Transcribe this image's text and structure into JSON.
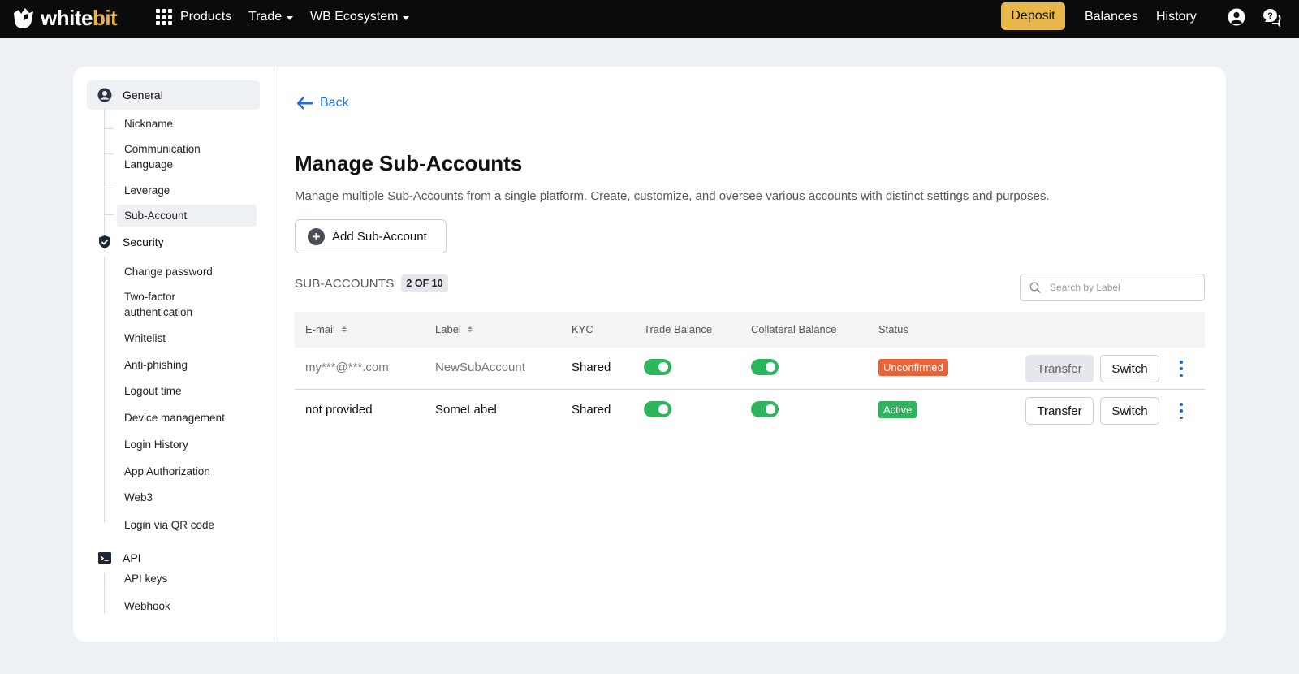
{
  "topnav": {
    "logo_text_main": "white",
    "logo_text_accent": "bit",
    "products_label": "Products",
    "trade_label": "Trade",
    "ecosystem_label": "WB Ecosystem",
    "deposit_label": "Deposit",
    "balances_label": "Balances",
    "history_label": "History",
    "deposit_color": "#e8b84b"
  },
  "sidebar": {
    "general_label": "General",
    "general_items": [
      "Nickname",
      "Communication\nLanguage",
      "Leverage",
      "Sub-Account"
    ],
    "security_label": "Security",
    "security_items": [
      "Change password",
      "Two-factor\nauthentication",
      "Whitelist",
      "Anti-phishing",
      "Logout time",
      "Device management",
      "Login History",
      "App Authorization",
      "Web3",
      "Login via QR code"
    ],
    "api_label": "API",
    "api_items": [
      "API keys",
      "Webhook"
    ]
  },
  "main": {
    "back_label": "Back",
    "title": "Manage Sub-Accounts",
    "description": "Manage multiple Sub-Accounts from a single platform. Create, customize, and oversee various accounts with distinct settings and purposes.",
    "add_button_label": "Add Sub-Account",
    "sub_accounts_label": "SUB-ACCOUNTS",
    "count_badge": "2 OF 10",
    "search_placeholder": "Search by Label",
    "link_color": "#1f6fd6"
  },
  "table": {
    "headers": {
      "email": "E-mail",
      "label": "Label",
      "kyc": "KYC",
      "trade_balance": "Trade Balance",
      "collateral_balance": "Collateral Balance",
      "status": "Status"
    },
    "rows": [
      {
        "email": "my***@***.com",
        "label": "NewSubAccount",
        "kyc": "Shared",
        "trade_balance_on": true,
        "collateral_balance_on": true,
        "status": "Unconfirmed",
        "status_color": "#e8633a",
        "transfer_label": "Transfer",
        "switch_label": "Switch"
      },
      {
        "email": "not provided",
        "label": "SomeLabel",
        "kyc": "Shared",
        "trade_balance_on": true,
        "collateral_balance_on": true,
        "status": "Active",
        "status_color": "#2db55d",
        "transfer_label": "Transfer",
        "switch_label": "Switch"
      }
    ]
  }
}
